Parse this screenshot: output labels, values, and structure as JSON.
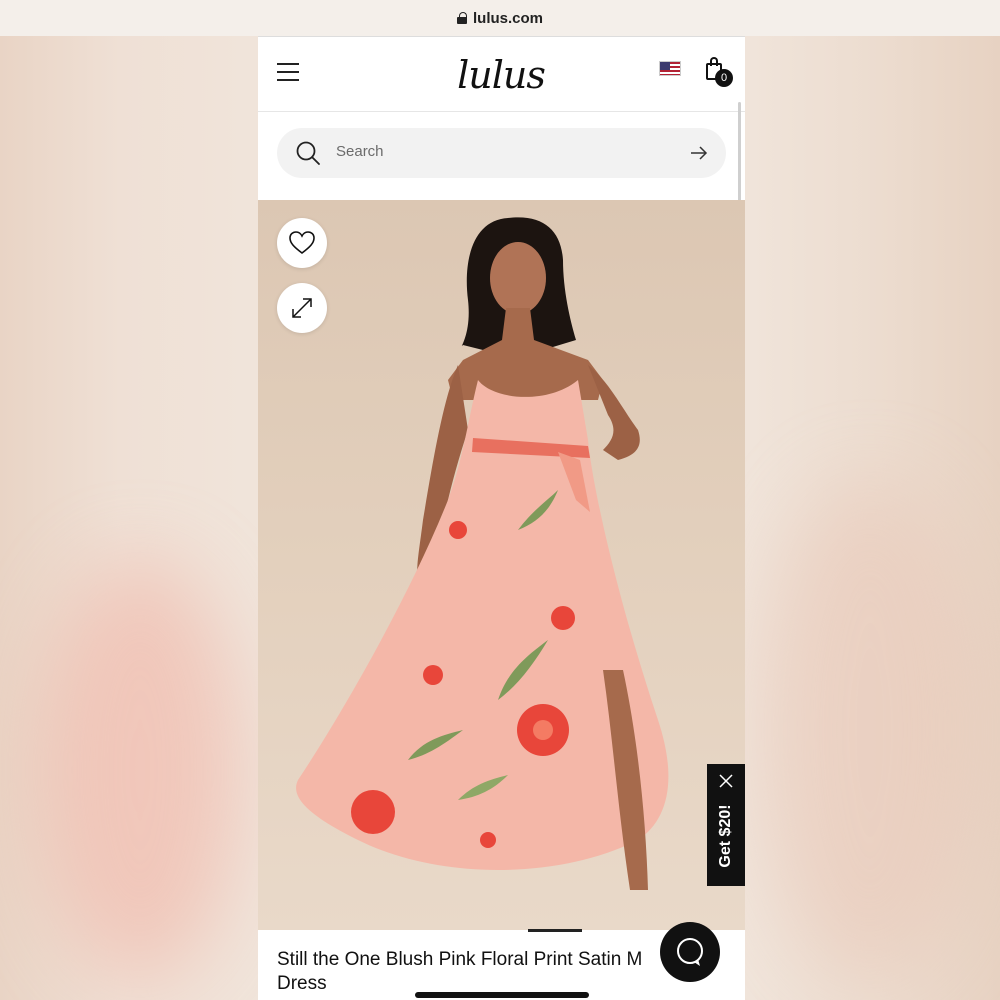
{
  "browser": {
    "url": "lulus.com"
  },
  "header": {
    "logo": "lulus",
    "cart_count": "0"
  },
  "search": {
    "placeholder": "Search"
  },
  "promo": {
    "label": "Get $20!"
  },
  "product": {
    "title": "Still the One Blush Pink Floral Print Satin M Dress"
  },
  "colors": {
    "promo_bg": "#111111",
    "search_bg": "#f2f2f2",
    "image_bg": "#dcc7b3",
    "dress": "#f4b7a8",
    "flower": "#e8463a",
    "leaf": "#7f9a5a"
  },
  "icons": [
    "lock-icon",
    "menu-icon",
    "us-flag-icon",
    "shopping-bag-icon",
    "search-icon",
    "arrow-right-icon",
    "heart-icon",
    "expand-icon",
    "close-icon",
    "chat-icon"
  ]
}
